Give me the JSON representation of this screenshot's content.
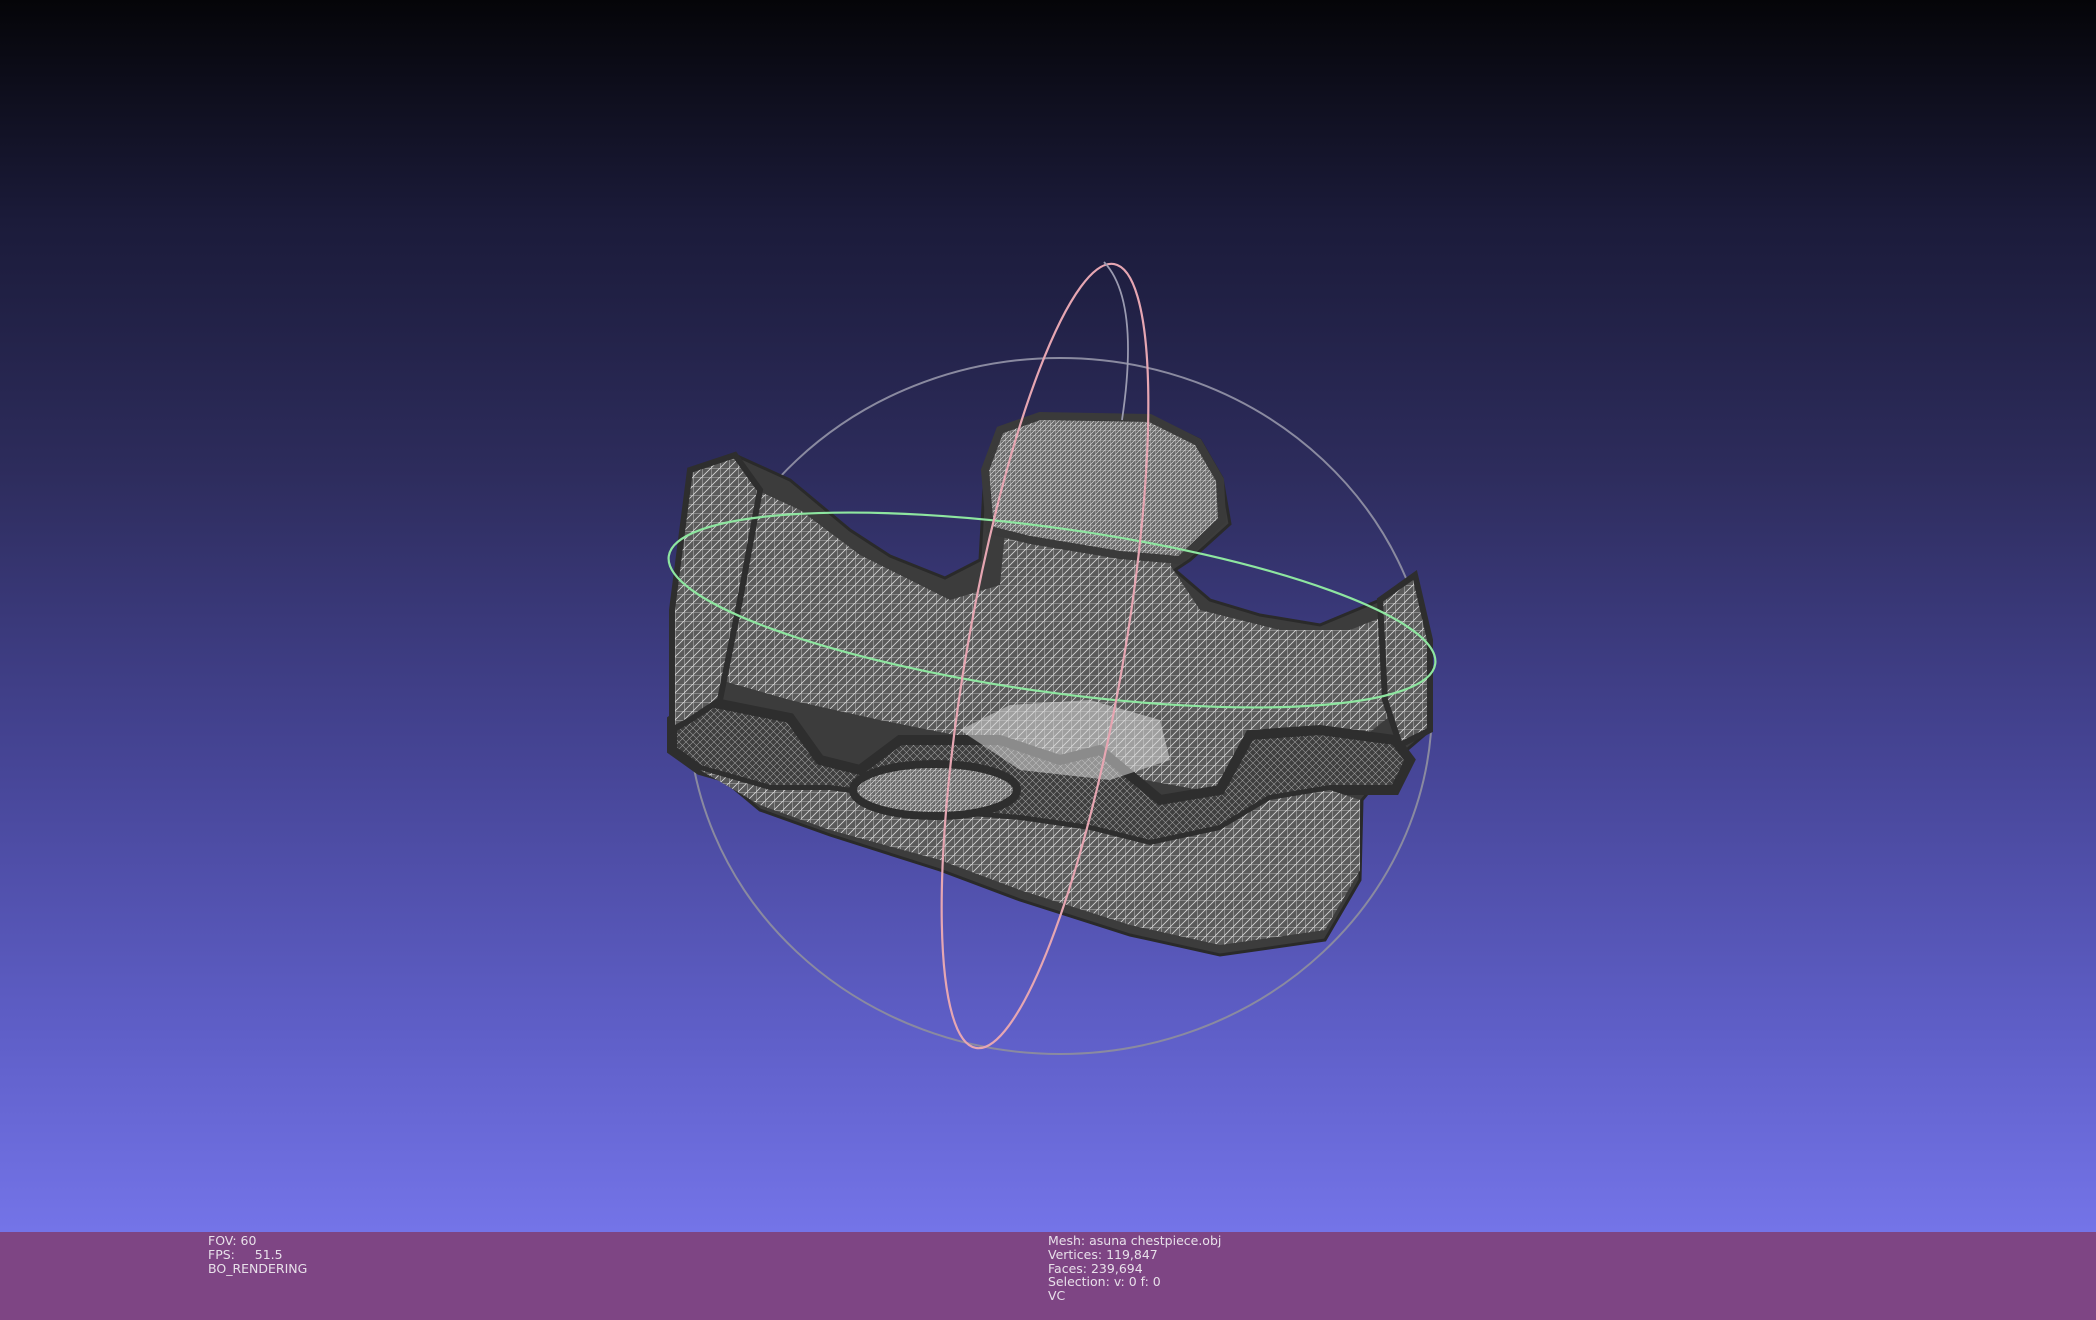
{
  "viewport": {
    "background_top": "#050508",
    "background_bottom": "#7474e8"
  },
  "trackball": {
    "x_ring_color": "#e6a6b2",
    "y_ring_color": "#8ee6a0",
    "z_ring_color": "#8a8aa0"
  },
  "mesh_render": {
    "mode": "wireframe",
    "fill_color": "#555555",
    "wire_color": "#d8d8d8"
  },
  "info_left": {
    "fov_label": "FOV:",
    "fov_value": "60",
    "fps_label": "FPS:",
    "fps_value": "51.5",
    "render_mode": "BO_RENDERING"
  },
  "info_right": {
    "mesh_label": "Mesh:",
    "mesh_name": "asuna chestpiece.obj",
    "vertices_label": "Vertices:",
    "vertices_value": "119,847",
    "faces_label": "Faces:",
    "faces_value": "239,694",
    "selection_label": "Selection:",
    "selection_value": "v: 0 f: 0",
    "color_mode": "VC"
  },
  "colors": {
    "infobar_bg": "#7e4584",
    "infobar_text": "#e8e0ea"
  }
}
